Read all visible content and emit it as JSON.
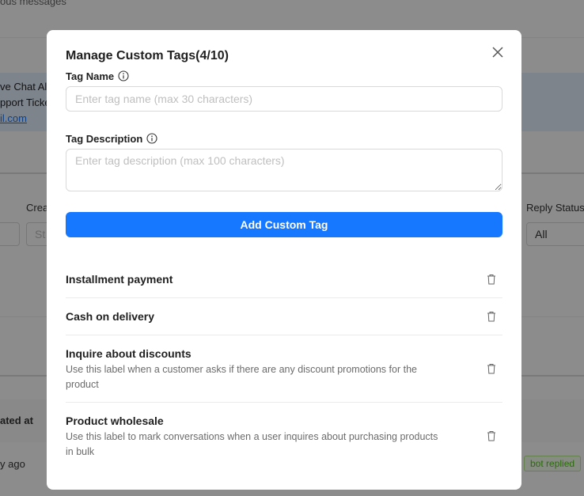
{
  "background": {
    "top_text": "ous messages",
    "banner_lines": [
      "ve Chat Als",
      "pport Ticke",
      "il.com"
    ],
    "filter_label_created": "Crea",
    "filter_label_reply": "Reply Status",
    "reply_select_value": "All",
    "created_placeholder": "St",
    "table_header_updated": "ated at",
    "row_time": "y ago",
    "row_badge": "bot replied"
  },
  "modal": {
    "title": "Manage Custom Tags(4/10)",
    "tag_name_label": "Tag Name",
    "tag_name_placeholder": "Enter tag name (max 30 characters)",
    "tag_desc_label": "Tag Description",
    "tag_desc_placeholder": "Enter tag description (max 100 characters)",
    "add_button": "Add Custom Tag",
    "tags": [
      {
        "name": "Installment payment",
        "description": ""
      },
      {
        "name": "Cash on delivery",
        "description": ""
      },
      {
        "name": "Inquire about discounts",
        "description": "Use this label when a customer asks if there are any discount promotions for the product"
      },
      {
        "name": "Product wholesale",
        "description": "Use this label to mark conversations when a user inquires about purchasing products in bulk"
      }
    ]
  },
  "colors": {
    "primary": "#1677ff",
    "overlay": "rgba(0,0,0,0.45)",
    "badge_green": "#52c41a"
  },
  "icons": {
    "close": "close-icon",
    "info": "info-circle-icon",
    "delete": "trash-icon"
  }
}
